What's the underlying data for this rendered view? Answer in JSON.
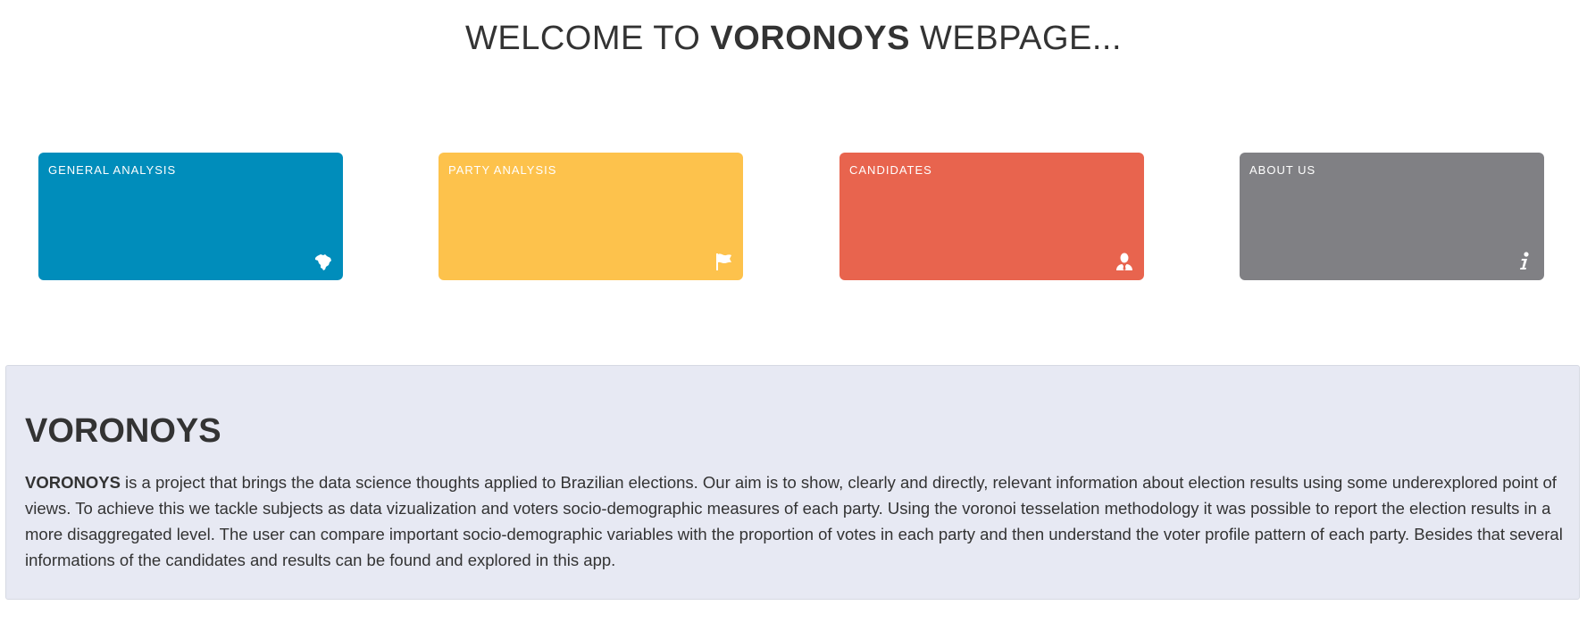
{
  "header": {
    "welcome_prefix": "WELCOME TO ",
    "welcome_brand": "VORONOYS",
    "welcome_suffix": " WEBPAGE..."
  },
  "tiles": [
    {
      "label": "GENERAL ANALYSIS",
      "color": "#008dbb",
      "icon": "brazil-map-icon"
    },
    {
      "label": "PARTY ANALYSIS",
      "color": "#fdc24c",
      "icon": "flag-icon"
    },
    {
      "label": "CANDIDATES",
      "color": "#e8644e",
      "icon": "user-tie-icon"
    },
    {
      "label": "ABOUT US",
      "color": "#808084",
      "icon": "info-icon"
    }
  ],
  "about": {
    "title": "VORONOYS",
    "text_brand": "VORONOYS",
    "text_body": " is a project that brings the data science thoughts applied to Brazilian elections. Our aim is to show, clearly and directly, relevant information about election results using some underexplored point of views. To achieve this we tackle subjects as data vizualization and voters socio-demographic measures of each party. Using the voronoi tesselation methodology it was possible to report the election results in a more disaggregated level. The user can compare important socio-demographic variables with the proportion of votes in each party and then understand the voter profile pattern of each party. Besides that several informations of the candidates and results can be found and explored in this app."
  }
}
